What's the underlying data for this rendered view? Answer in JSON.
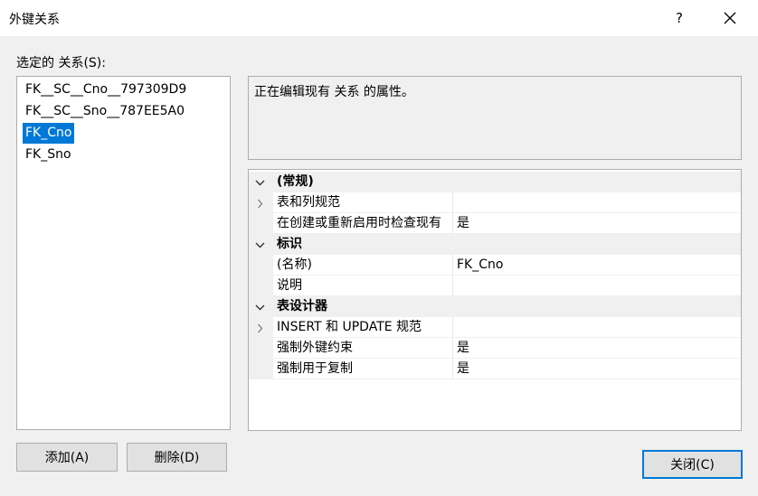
{
  "window": {
    "title": "外键关系",
    "help_label": "?"
  },
  "left": {
    "label": "选定的 关系(S):",
    "relationships": [
      "FK__SC__Cno__797309D9",
      "FK__SC__Sno__787EE5A0",
      "FK_Cno",
      "FK_Sno"
    ],
    "selected_index": 2
  },
  "description": "正在编辑现有 关系 的属性。",
  "properties": {
    "categories": [
      {
        "label": "(常规)",
        "expanded": true,
        "items": [
          {
            "name": "表和列规范",
            "value": "",
            "expandable": true
          },
          {
            "name": "在创建或重新启用时检查现有",
            "value": "是",
            "expandable": false
          }
        ]
      },
      {
        "label": "标识",
        "expanded": true,
        "items": [
          {
            "name": "(名称)",
            "value": "FK_Cno",
            "expandable": false
          },
          {
            "name": "说明",
            "value": "",
            "expandable": false
          }
        ]
      },
      {
        "label": "表设计器",
        "expanded": true,
        "items": [
          {
            "name": "INSERT 和 UPDATE 规范",
            "value": "",
            "expandable": true
          },
          {
            "name": "强制外键约束",
            "value": "是",
            "expandable": false
          },
          {
            "name": "强制用于复制",
            "value": "是",
            "expandable": false
          }
        ]
      }
    ]
  },
  "buttons": {
    "add": "添加(A)",
    "delete": "删除(D)",
    "close": "关闭(C)"
  },
  "colors": {
    "selection": "#0078d7",
    "window_bg": "#f0f0f0",
    "border": "#adadad"
  }
}
